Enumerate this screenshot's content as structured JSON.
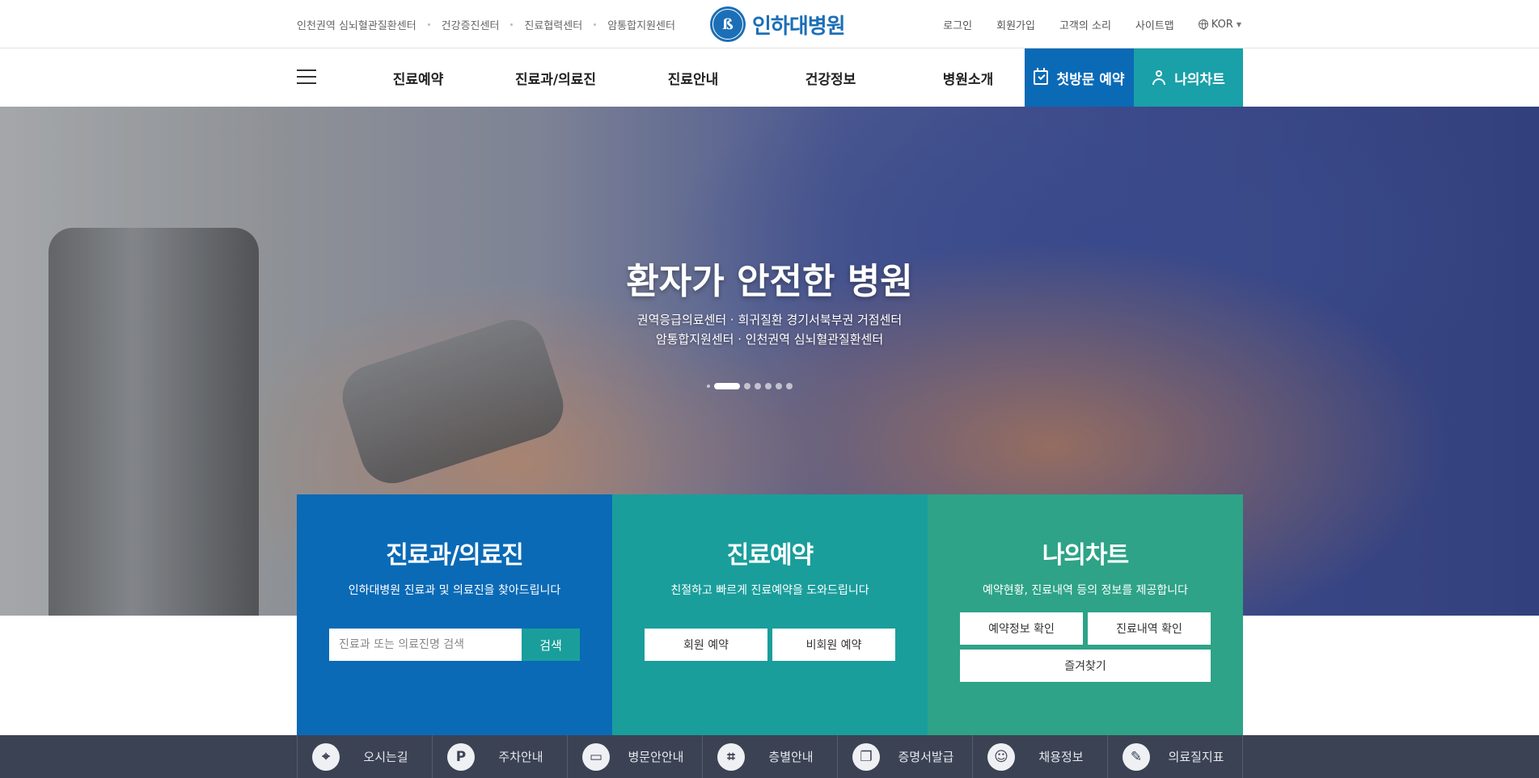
{
  "utility": {
    "left_links": [
      "인천권역 심뇌혈관질환센터",
      "건강증진센터",
      "진료협력센터",
      "암통합지원센터"
    ],
    "logo_text": "인하대병원",
    "right_links": [
      "로그인",
      "회원가입",
      "고객의 소리",
      "사이트맵"
    ],
    "lang": "KOR"
  },
  "gnb": {
    "menu": [
      "진료예약",
      "진료과/의료진",
      "진료안내",
      "건강정보",
      "병원소개"
    ],
    "first_visit": "첫방문 예약",
    "my_chart": "나의차트"
  },
  "hero": {
    "title": "환자가 안전한 병원",
    "sub_line1": "권역응급의료센터 · 희귀질환 경기서북부권 거점센터",
    "sub_line2": "암통합지원센터 · 인천권역 심뇌혈관질환센터",
    "slide_count": 7,
    "active_slide": 2
  },
  "panels": {
    "departments": {
      "title": "진료과/의료진",
      "desc": "인하대병원 진료과 및 의료진을 찾아드립니다",
      "search_placeholder": "진료과 또는 의료진명 검색",
      "search_button": "검색"
    },
    "reservation": {
      "title": "진료예약",
      "desc": "친절하고 빠르게 진료예약을 도와드립니다",
      "member_button": "회원 예약",
      "guest_button": "비회원 예약"
    },
    "mychart": {
      "title": "나의차트",
      "desc": "예약현황, 진료내역 등의 정보를 제공합니다",
      "reservation_info_button": "예약정보 확인",
      "history_button": "진료내역 확인",
      "favorites_button": "즐겨찾기"
    }
  },
  "quickbar": {
    "items": [
      {
        "label": "오시는길",
        "icon": "map-pin-icon",
        "glyph": "⌖"
      },
      {
        "label": "주차안내",
        "icon": "parking-icon",
        "glyph": "P"
      },
      {
        "label": "병문안안내",
        "icon": "bed-icon",
        "glyph": "▭"
      },
      {
        "label": "층별안내",
        "icon": "stairs-icon",
        "glyph": "⌗"
      },
      {
        "label": "증명서발급",
        "icon": "document-icon",
        "glyph": "❐"
      },
      {
        "label": "채용정보",
        "icon": "people-icon",
        "glyph": "☺"
      },
      {
        "label": "의료질지표",
        "icon": "clipboard-icon",
        "glyph": "✎"
      }
    ]
  }
}
